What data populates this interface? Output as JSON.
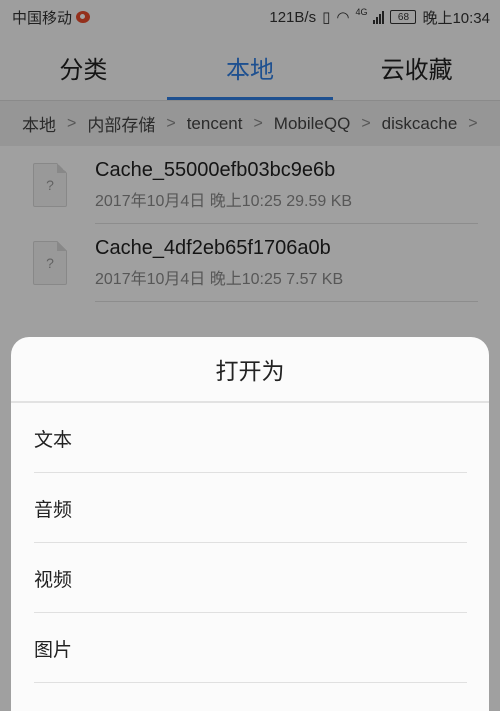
{
  "statusbar": {
    "carrier": "中国移动",
    "speed": "121B/s",
    "network": "4G",
    "battery": "68",
    "time": "晚上10:34"
  },
  "tabs": [
    {
      "label": "分类"
    },
    {
      "label": "本地"
    },
    {
      "label": "云收藏"
    }
  ],
  "breadcrumb": [
    "本地",
    "内部存储",
    "tencent",
    "MobileQQ",
    "diskcache"
  ],
  "files": [
    {
      "icon": "?",
      "name": "Cache_55000efb03bc9e6b",
      "meta": "2017年10月4日 晚上10:25 29.59 KB"
    },
    {
      "icon": "?",
      "name": "Cache_4df2eb65f1706a0b",
      "meta": "2017年10月4日 晚上10:25 7.57 KB"
    }
  ],
  "sheet": {
    "title": "打开为",
    "options": [
      "文本",
      "音频",
      "视频",
      "图片"
    ]
  },
  "colors": {
    "accent": "#2f7de1"
  }
}
